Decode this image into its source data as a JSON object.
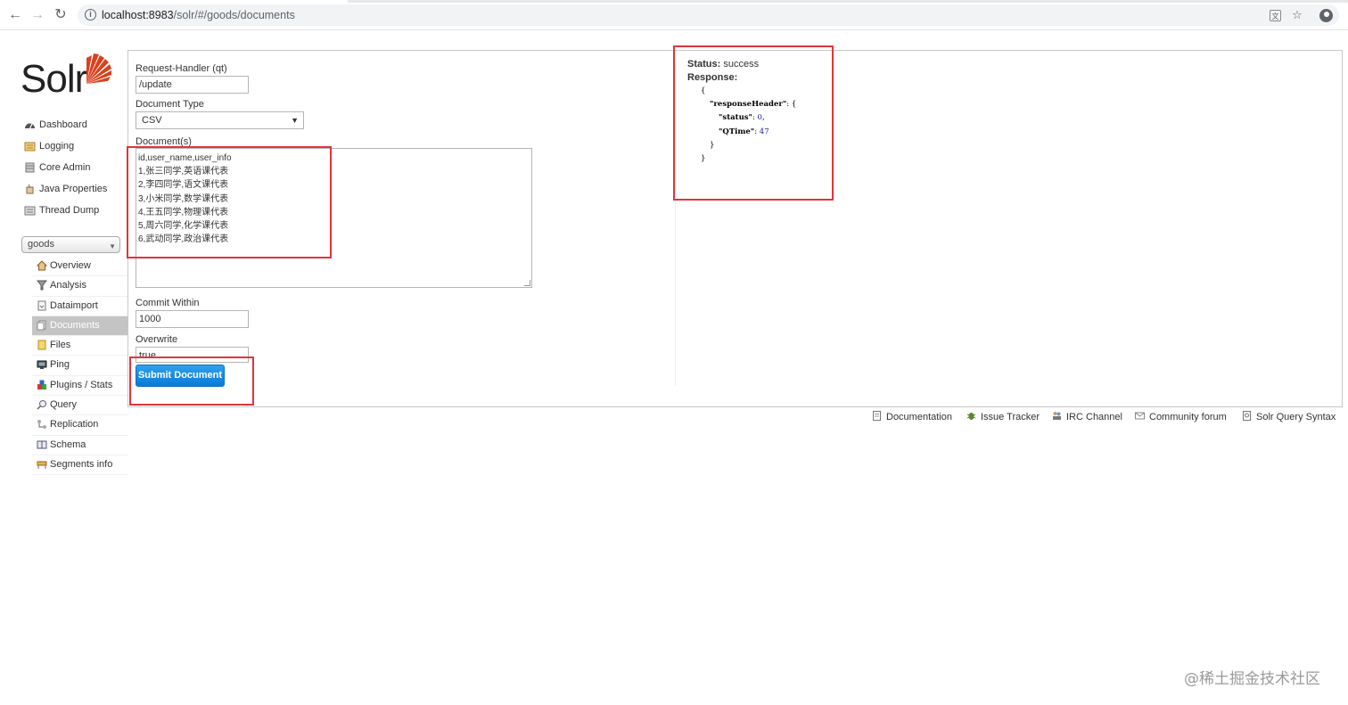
{
  "browser": {
    "url_host": "localhost:8983",
    "url_path": "/solr/#/goods/documents"
  },
  "logo": {
    "text": "Solr"
  },
  "sidebar": {
    "items": [
      {
        "label": "Dashboard",
        "icon": "dashboard-icon"
      },
      {
        "label": "Logging",
        "icon": "logging-icon"
      },
      {
        "label": "Core Admin",
        "icon": "core-admin-icon"
      },
      {
        "label": "Java Properties",
        "icon": "java-properties-icon"
      },
      {
        "label": "Thread Dump",
        "icon": "thread-dump-icon"
      }
    ],
    "core_selected": "goods",
    "core_items": [
      {
        "label": "Overview",
        "icon": "overview-icon"
      },
      {
        "label": "Analysis",
        "icon": "analysis-icon"
      },
      {
        "label": "Dataimport",
        "icon": "dataimport-icon"
      },
      {
        "label": "Documents",
        "icon": "documents-icon",
        "active": true
      },
      {
        "label": "Files",
        "icon": "files-icon"
      },
      {
        "label": "Ping",
        "icon": "ping-icon"
      },
      {
        "label": "Plugins / Stats",
        "icon": "plugins-icon"
      },
      {
        "label": "Query",
        "icon": "query-icon"
      },
      {
        "label": "Replication",
        "icon": "replication-icon"
      },
      {
        "label": "Schema",
        "icon": "schema-icon"
      },
      {
        "label": "Segments info",
        "icon": "segments-icon"
      }
    ]
  },
  "form": {
    "request_handler_label": "Request-Handler (qt)",
    "request_handler_value": "/update",
    "document_type_label": "Document Type",
    "document_type_value": "CSV",
    "documents_label": "Document(s)",
    "documents_lines": [
      "id,user_name,user_info",
      "1,张三同学,英语课代表",
      "2,李四同学,语文课代表",
      "3,小米同学,数学课代表",
      "4,王五同学,物理课代表",
      "5,周六同学,化学课代表",
      "6,武动同学,政治课代表"
    ],
    "commit_within_label": "Commit Within",
    "commit_within_value": "1000",
    "overwrite_label": "Overwrite",
    "overwrite_value": "true",
    "submit_label": "Submit Document"
  },
  "response": {
    "status_label": "Status:",
    "status_value": "success",
    "response_label": "Response:",
    "json_open": "{",
    "header_key": "\"responseHeader\"",
    "status_key": "\"status\"",
    "status_num": "0",
    "qtime_key": "\"QTime\"",
    "qtime_num": "47",
    "inner_close": "}",
    "outer_close": "}"
  },
  "footer": {
    "links": [
      {
        "label": "Documentation",
        "icon": "documentation-icon"
      },
      {
        "label": "Issue Tracker",
        "icon": "issue-tracker-icon"
      },
      {
        "label": "IRC Channel",
        "icon": "irc-channel-icon"
      },
      {
        "label": "Community forum",
        "icon": "community-forum-icon"
      },
      {
        "label": "Solr Query Syntax",
        "icon": "query-syntax-icon"
      }
    ]
  },
  "watermark": "@稀土掘金技术社区",
  "colors": {
    "highlight": "#e0343c",
    "submit_button": "#0a7bd6",
    "active_menu": "#c4c4c4",
    "logo_accent": "#d9411e"
  }
}
